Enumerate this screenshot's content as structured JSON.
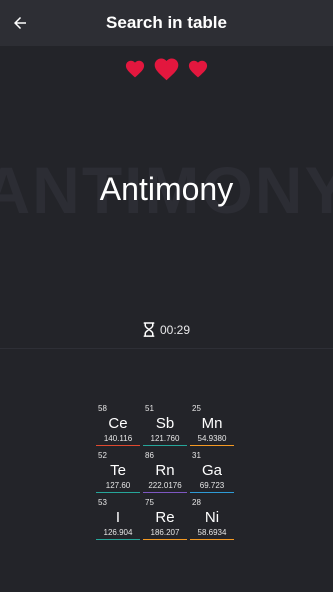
{
  "header": {
    "title": "Search in table",
    "back_icon": "arrow-left-icon"
  },
  "lives": {
    "count": 3,
    "icon": "heart-icon",
    "color": "#e3173e"
  },
  "quiz": {
    "watermark": "ANTIMONY",
    "element_name": "Antimony"
  },
  "timer": {
    "icon": "hourglass-icon",
    "value": "00:29"
  },
  "tiles": [
    {
      "number": "58",
      "symbol": "Ce",
      "mass": "140.116",
      "color": "#e0492f"
    },
    {
      "number": "51",
      "symbol": "Sb",
      "mass": "121.760",
      "color": "#26a69a"
    },
    {
      "number": "25",
      "symbol": "Mn",
      "mass": "54.9380",
      "color": "#f59a23"
    },
    {
      "number": "52",
      "symbol": "Te",
      "mass": "127.60",
      "color": "#26a69a"
    },
    {
      "number": "86",
      "symbol": "Rn",
      "mass": "222.0176",
      "color": "#7e57c2"
    },
    {
      "number": "31",
      "symbol": "Ga",
      "mass": "69.723",
      "color": "#2e9bd6"
    },
    {
      "number": "53",
      "symbol": "I",
      "mass": "126.904",
      "color": "#26a69a"
    },
    {
      "number": "75",
      "symbol": "Re",
      "mass": "186.207",
      "color": "#f59a23"
    },
    {
      "number": "28",
      "symbol": "Ni",
      "mass": "58.6934",
      "color": "#f59a23"
    }
  ]
}
